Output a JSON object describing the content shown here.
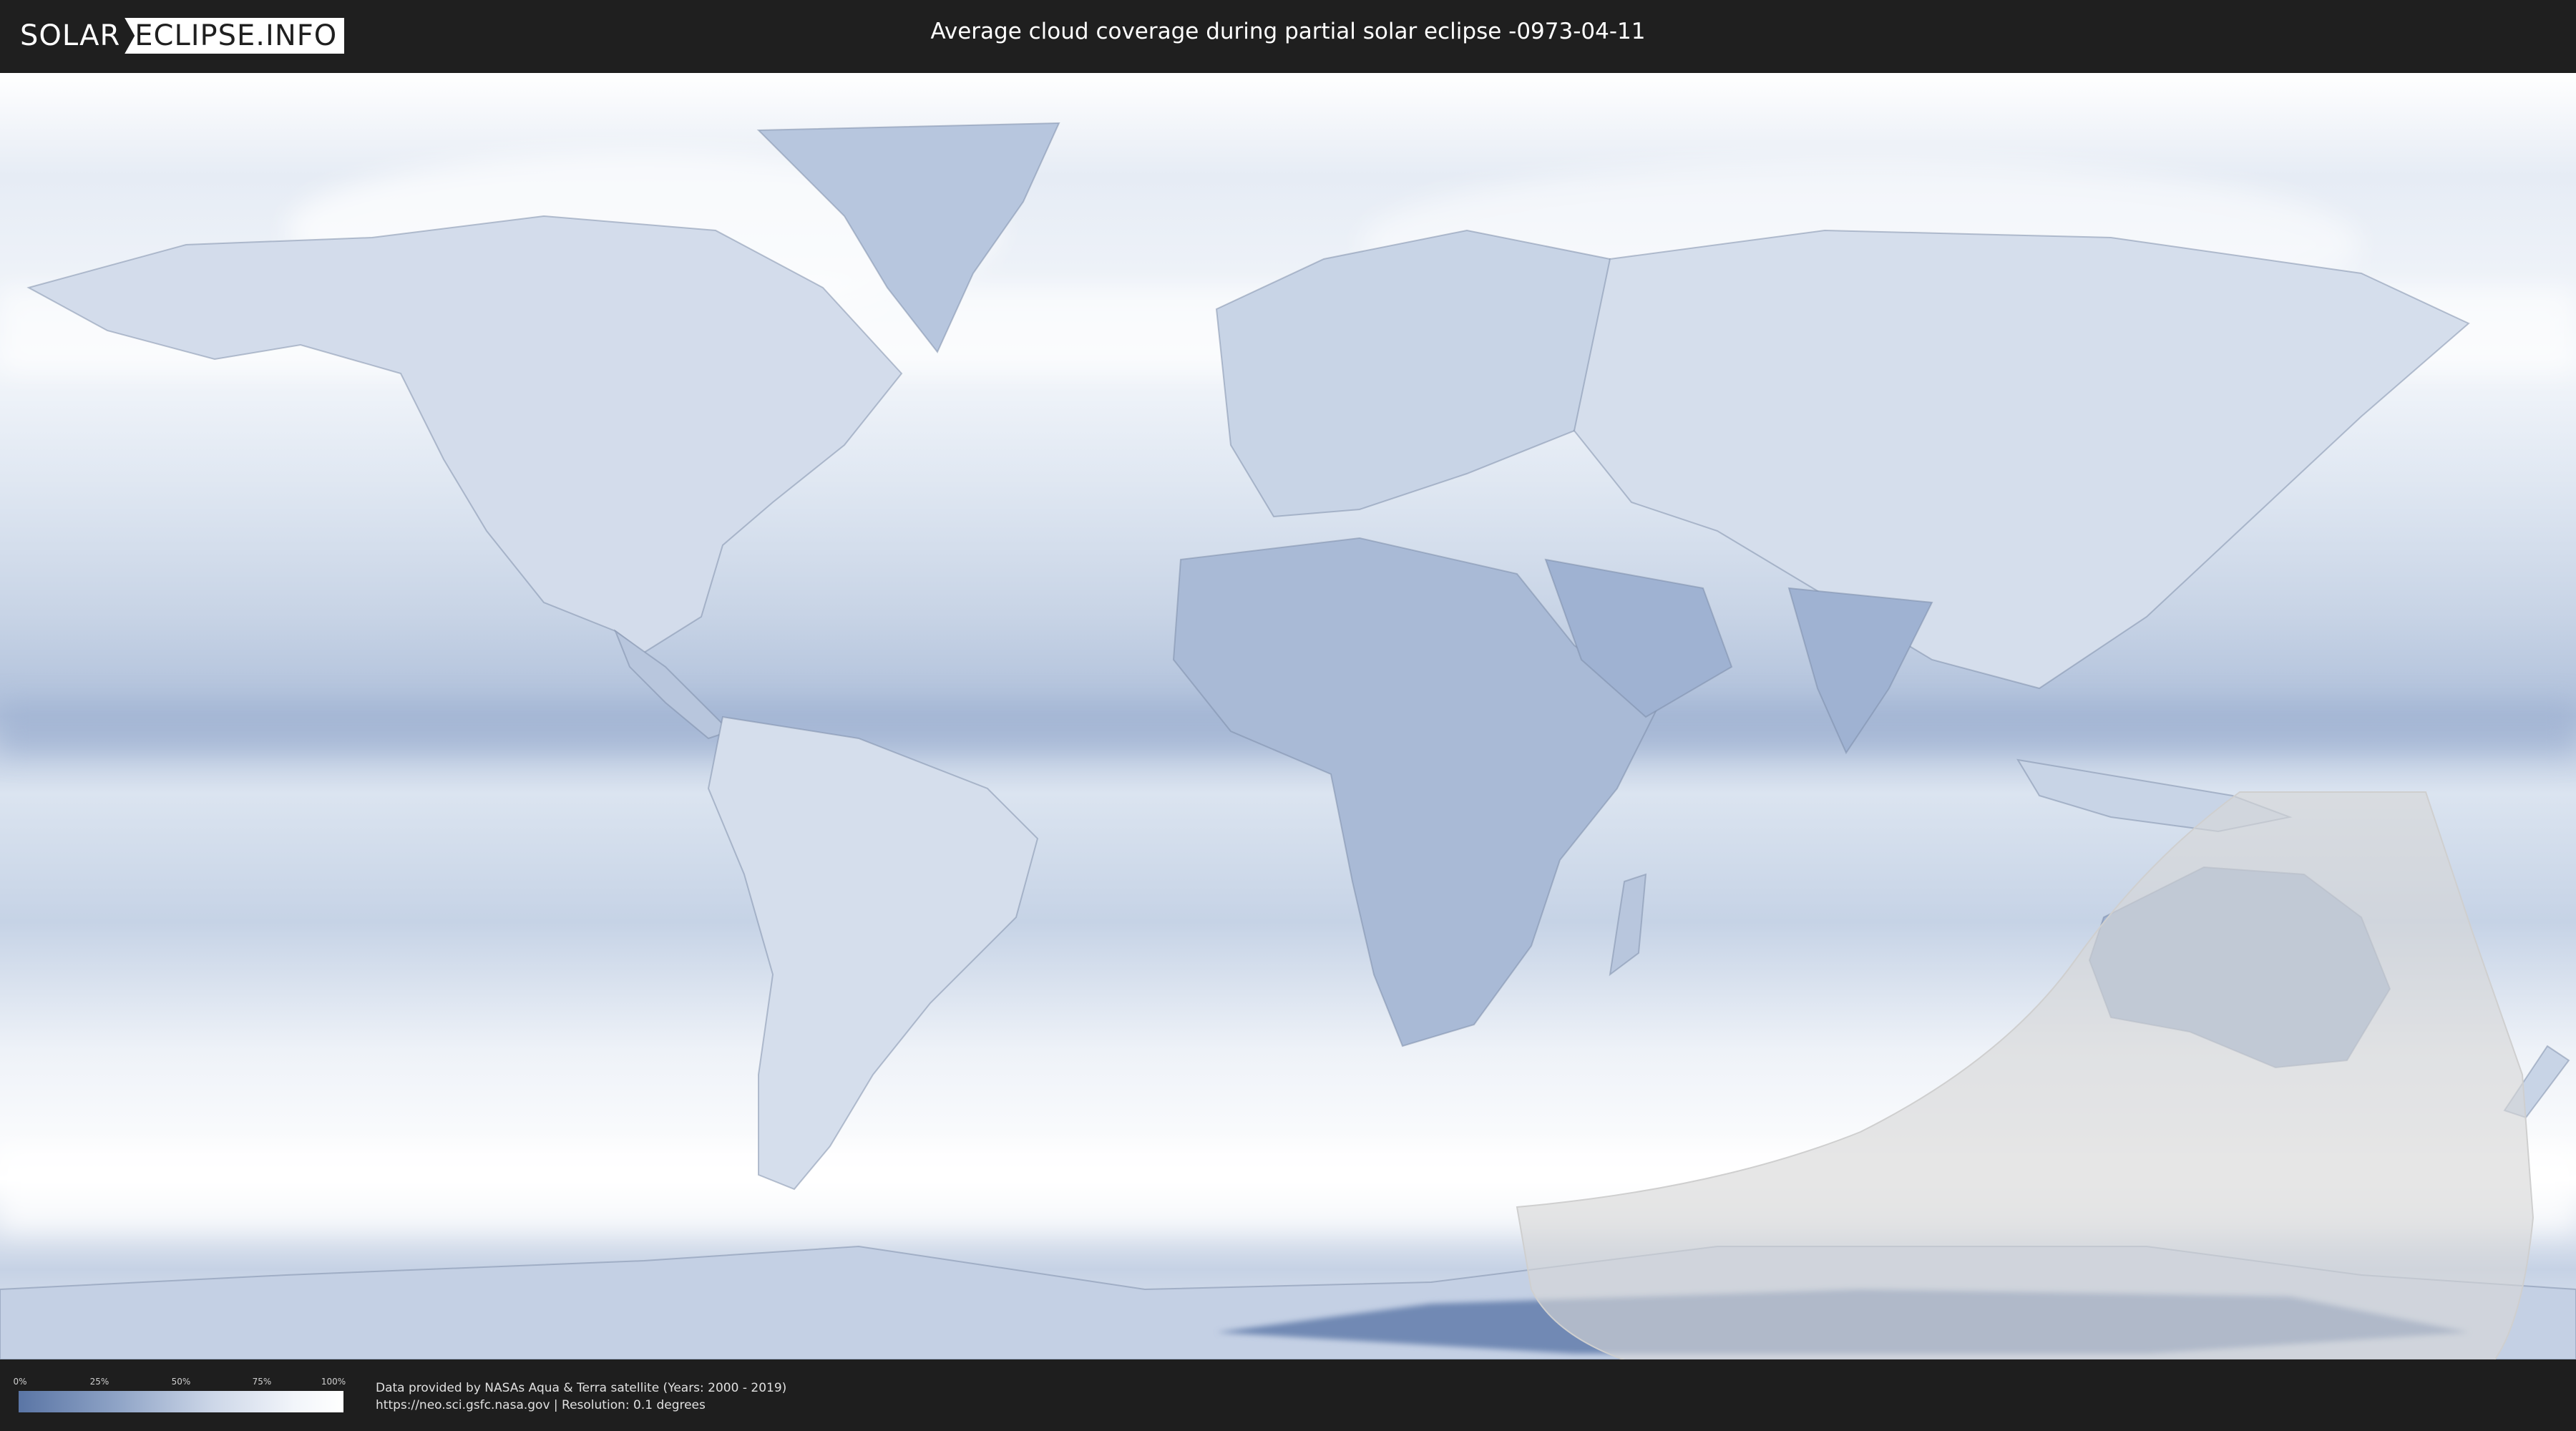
{
  "header": {
    "logo_part1": "SOLAR",
    "logo_part2": "ECLIPSE.INFO",
    "title": "Average cloud coverage during partial solar eclipse -0973-04-11"
  },
  "legend": {
    "ticks": [
      "0%",
      "25%",
      "50%",
      "75%",
      "100%"
    ],
    "gradient_colors": [
      "#5a75a5",
      "#8ea3c6",
      "#cdd7e8",
      "#f2f5fa",
      "#ffffff"
    ]
  },
  "footer": {
    "line1": "Data provided by NASAs Aqua & Terra satellite (Years: 2000 - 2019)",
    "line2": "https://neo.sci.gsfc.nasa.gov | Resolution: 0.1 degrees"
  },
  "map": {
    "ocean_color": "#dde6f1",
    "cloud_color": "#ffffff",
    "clear_color": "#5f7eaa",
    "eclipse_overlay_color": "#d6d6d6"
  }
}
